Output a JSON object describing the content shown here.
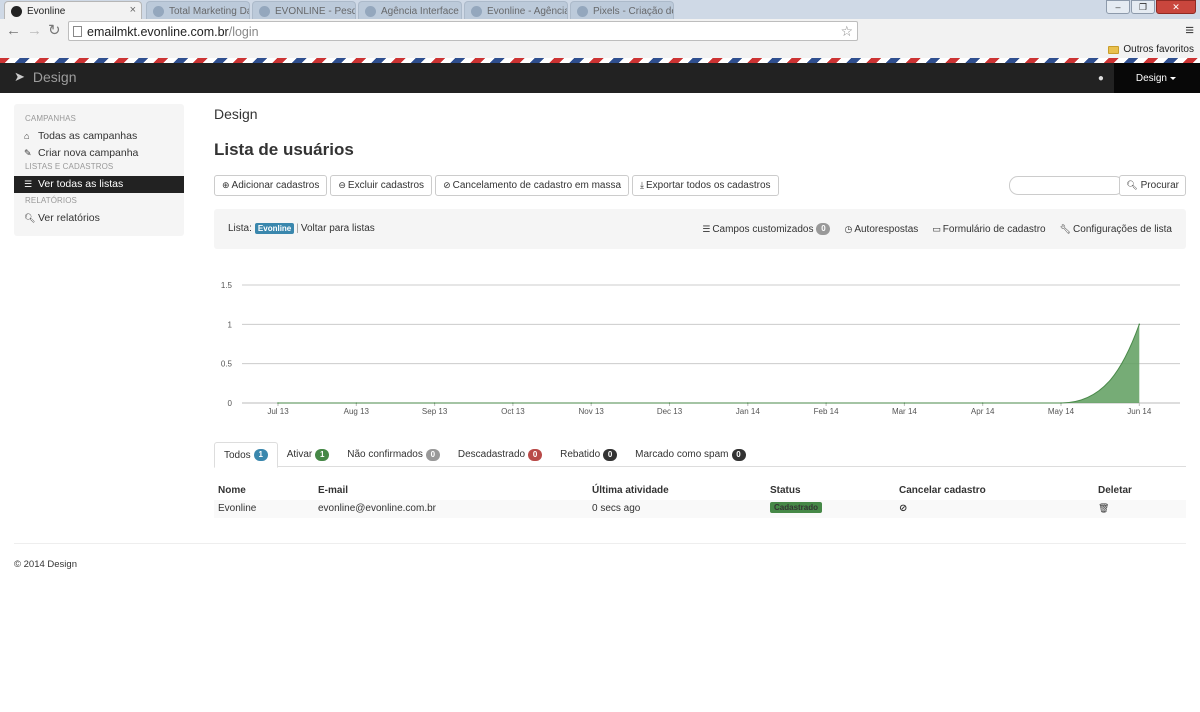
{
  "browser": {
    "tabs": [
      {
        "title": "Evonline",
        "active": true
      },
      {
        "title": "Total Marketing Day - Super...",
        "active": false
      },
      {
        "title": "EVONLINE - Pesquisa Goo...",
        "active": false
      },
      {
        "title": "Agência Interface de comunica...",
        "active": false
      },
      {
        "title": "Evonline - Agência...",
        "active": false
      },
      {
        "title": "Pixels - Criação de sites e...",
        "active": false
      }
    ],
    "url_host": "emailmkt.evonline.com.br",
    "url_path": "/login",
    "bookmark_folder": "Outros favoritos"
  },
  "navbar": {
    "brand": "Design",
    "user_menu": "Design"
  },
  "sidebar": {
    "sections": [
      {
        "heading": "CAMPANHAS",
        "items": [
          {
            "label": "Todas as campanhas",
            "icon": "home-icon",
            "active": false
          },
          {
            "label": "Criar nova campanha",
            "icon": "edit-icon",
            "active": false
          }
        ]
      },
      {
        "heading": "LISTAS E CADASTROS",
        "items": [
          {
            "label": "Ver todas as listas",
            "icon": "list-icon",
            "active": true
          }
        ]
      },
      {
        "heading": "RELATÓRIOS",
        "items": [
          {
            "label": "Ver relatórios",
            "icon": "search-icon",
            "active": false
          }
        ]
      }
    ]
  },
  "main": {
    "breadcrumb": "Design",
    "title": "Lista de usuários",
    "actions": [
      {
        "label": "Adicionar cadastros",
        "icon": "plus-circle-icon"
      },
      {
        "label": "Excluir cadastros",
        "icon": "minus-circle-icon"
      },
      {
        "label": "Cancelamento de cadastro em massa",
        "icon": "ban-icon"
      },
      {
        "label": "Exportar todos os cadastros",
        "icon": "download-icon"
      }
    ],
    "search_button": "Procurar",
    "list_bar": {
      "prefix": "Lista:",
      "list_name": "Evonline",
      "back_link": "Voltar para listas",
      "links": [
        {
          "label": "Campos customizados",
          "icon": "list-icon",
          "badge": "0"
        },
        {
          "label": "Autorespostas",
          "icon": "clock-icon",
          "badge": ""
        },
        {
          "label": "Formulário de cadastro",
          "icon": "form-icon",
          "badge": ""
        },
        {
          "label": "Configurações de lista",
          "icon": "wrench-icon",
          "badge": ""
        }
      ]
    },
    "tabs": [
      {
        "label": "Todos",
        "badge": "1",
        "color": "#3a87ad",
        "active": true
      },
      {
        "label": "Ativar",
        "badge": "1",
        "color": "#468847",
        "active": false
      },
      {
        "label": "Não confirmados",
        "badge": "0",
        "color": "#999999",
        "active": false
      },
      {
        "label": "Descadastrado",
        "badge": "0",
        "color": "#b94a48",
        "active": false
      },
      {
        "label": "Rebatido",
        "badge": "0",
        "color": "#333333",
        "active": false
      },
      {
        "label": "Marcado como spam",
        "badge": "0",
        "color": "#333333",
        "active": false
      }
    ],
    "table": {
      "headers": [
        "Nome",
        "E-mail",
        "Última atividade",
        "Status",
        "Cancelar cadastro",
        "Deletar"
      ],
      "rows": [
        {
          "name": "Evonline",
          "email": "evonline@evonline.com.br",
          "last_activity": "0 secs ago",
          "status": "Cadastrado"
        }
      ]
    }
  },
  "footer": "© 2014 Design",
  "chart_data": {
    "type": "area",
    "categories": [
      "Jul 13",
      "Aug 13",
      "Sep 13",
      "Oct 13",
      "Nov 13",
      "Dec 13",
      "Jan 14",
      "Feb 14",
      "Mar 14",
      "Apr 14",
      "May 14",
      "Jun 14"
    ],
    "series": [
      {
        "values": [
          0,
          0,
          0,
          0,
          0,
          0,
          0,
          0,
          0,
          0,
          0,
          1
        ]
      }
    ],
    "yticks": [
      "0",
      "0.5",
      "1",
      "1.5"
    ],
    "ylim": [
      0,
      1.5
    ],
    "grid": true,
    "color": "#5e9e5e"
  }
}
